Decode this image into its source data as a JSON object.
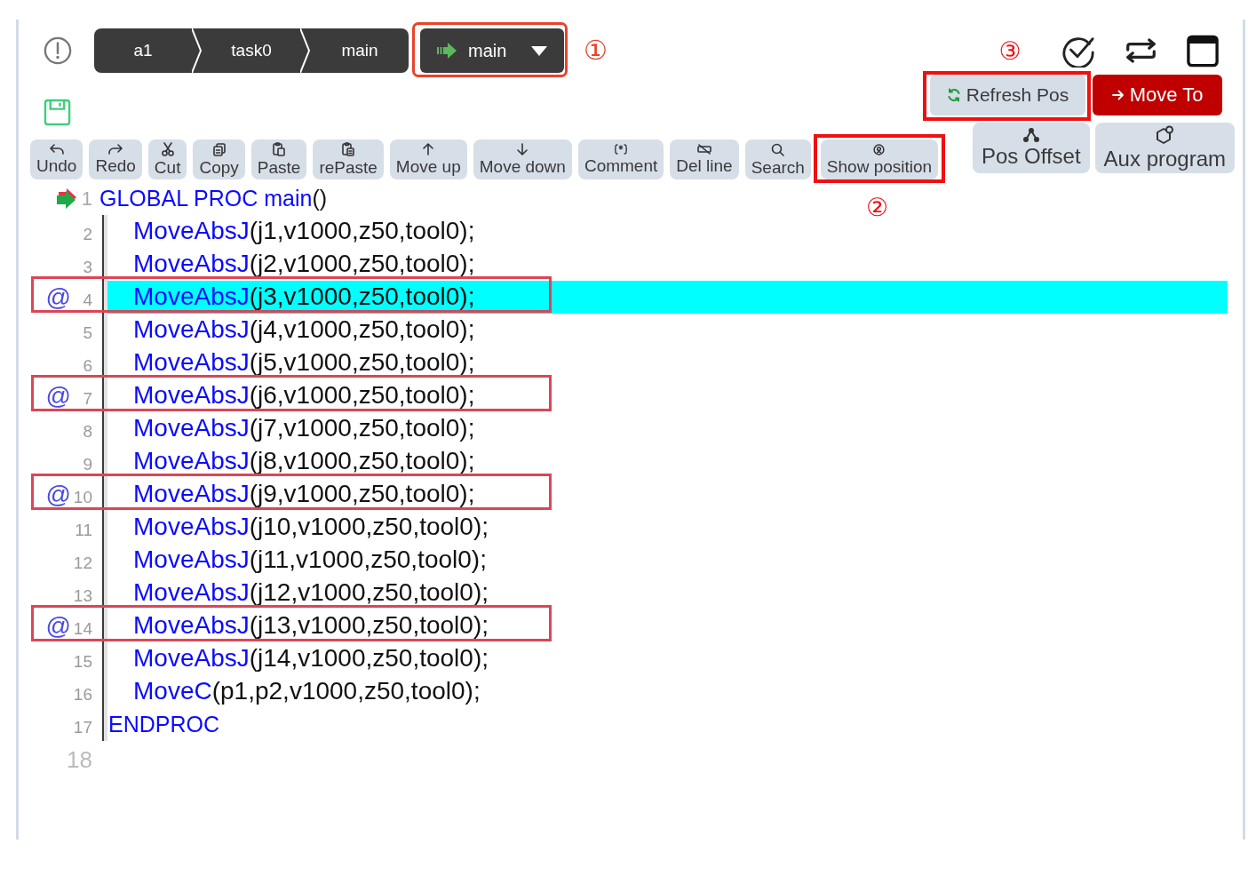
{
  "header": {
    "breadcrumb": [
      {
        "label": "a1"
      },
      {
        "label": "task0"
      },
      {
        "label": "main"
      }
    ],
    "routine_selector": {
      "label": "main",
      "annotated": true,
      "callout": "①"
    }
  },
  "position_actions": [
    {
      "label": "Refresh Pos",
      "kind": "refresh",
      "annotated": true,
      "callout": "③"
    },
    {
      "label": "Move To",
      "kind": "move",
      "annotated": false
    }
  ],
  "toolbar": [
    {
      "label": "Undo",
      "kind": "undo",
      "annotated": false
    },
    {
      "label": "Redo",
      "kind": "redo",
      "annotated": false
    },
    {
      "label": "Cut",
      "kind": "cut",
      "annotated": false
    },
    {
      "label": "Copy",
      "kind": "copy",
      "annotated": false
    },
    {
      "label": "Paste",
      "kind": "paste",
      "annotated": false
    },
    {
      "label": "rePaste",
      "kind": "repaste",
      "annotated": false
    },
    {
      "label": "Move up",
      "kind": "up",
      "annotated": false
    },
    {
      "label": "Move down",
      "kind": "down",
      "annotated": false
    },
    {
      "label": "Comment",
      "kind": "comment",
      "annotated": false
    },
    {
      "label": "Del line",
      "kind": "delete",
      "annotated": false
    },
    {
      "label": "Search",
      "kind": "search",
      "annotated": false
    },
    {
      "label": "Show position",
      "kind": "position",
      "annotated": true,
      "callout": "②"
    }
  ],
  "side_tools": [
    {
      "label": "Pos Offset",
      "kind": "offset"
    },
    {
      "label": "Aux program",
      "kind": "aux"
    }
  ],
  "editor": {
    "lines": [
      {
        "number": "1",
        "pointer": true,
        "highlighted": false,
        "annotated": false,
        "keyword": "GLOBAL PROC main",
        "args": "()",
        "children": [
          {
            "number": "2",
            "pointer": false,
            "highlighted": false,
            "annotated": false,
            "keyword": "MoveAbsJ",
            "args": "(j1,v1000,z50,tool0);"
          },
          {
            "number": "3",
            "pointer": false,
            "highlighted": false,
            "annotated": false,
            "keyword": "MoveAbsJ",
            "args": "(j2,v1000,z50,tool0);"
          },
          {
            "number": "4",
            "marker": "@",
            "pointer": false,
            "highlighted": true,
            "annotated": true,
            "keyword": "MoveAbsJ",
            "args": "(j3,v1000,z50,tool0);"
          },
          {
            "number": "5",
            "pointer": false,
            "highlighted": false,
            "annotated": false,
            "keyword": "MoveAbsJ",
            "args": "(j4,v1000,z50,tool0);"
          },
          {
            "number": "6",
            "pointer": false,
            "highlighted": false,
            "annotated": false,
            "keyword": "MoveAbsJ",
            "args": "(j5,v1000,z50,tool0);"
          },
          {
            "number": "7",
            "marker": "@",
            "pointer": false,
            "highlighted": false,
            "annotated": true,
            "keyword": "MoveAbsJ",
            "args": "(j6,v1000,z50,tool0);"
          },
          {
            "number": "8",
            "pointer": false,
            "highlighted": false,
            "annotated": false,
            "keyword": "MoveAbsJ",
            "args": "(j7,v1000,z50,tool0);"
          },
          {
            "number": "9",
            "pointer": false,
            "highlighted": false,
            "annotated": false,
            "keyword": "MoveAbsJ",
            "args": "(j8,v1000,z50,tool0);"
          },
          {
            "number": "10",
            "marker": "@",
            "pointer": false,
            "highlighted": false,
            "annotated": true,
            "keyword": "MoveAbsJ",
            "args": "(j9,v1000,z50,tool0);"
          },
          {
            "number": "11",
            "pointer": false,
            "highlighted": false,
            "annotated": false,
            "keyword": "MoveAbsJ",
            "args": "(j10,v1000,z50,tool0);"
          },
          {
            "number": "12",
            "pointer": false,
            "highlighted": false,
            "annotated": false,
            "keyword": "MoveAbsJ",
            "args": "(j11,v1000,z50,tool0);"
          },
          {
            "number": "13",
            "pointer": false,
            "highlighted": false,
            "annotated": false,
            "keyword": "MoveAbsJ",
            "args": "(j12,v1000,z50,tool0);"
          },
          {
            "number": "14",
            "marker": "@",
            "pointer": false,
            "highlighted": false,
            "annotated": true,
            "keyword": "MoveAbsJ",
            "args": "(j13,v1000,z50,tool0);"
          },
          {
            "number": "15",
            "pointer": false,
            "highlighted": false,
            "annotated": false,
            "keyword": "MoveAbsJ",
            "args": "(j14,v1000,z50,tool0);"
          },
          {
            "number": "16",
            "pointer": false,
            "highlighted": false,
            "annotated": false,
            "keyword": "MoveC",
            "args": "(p1,p2,v1000,z50,tool0);"
          }
        ]
      },
      {
        "number": "17",
        "pointer": false,
        "highlighted": false,
        "annotated": false,
        "keyword": "ENDPROC"
      },
      {
        "number": "18",
        "pointer": false,
        "highlighted": false,
        "annotated": false
      }
    ]
  }
}
